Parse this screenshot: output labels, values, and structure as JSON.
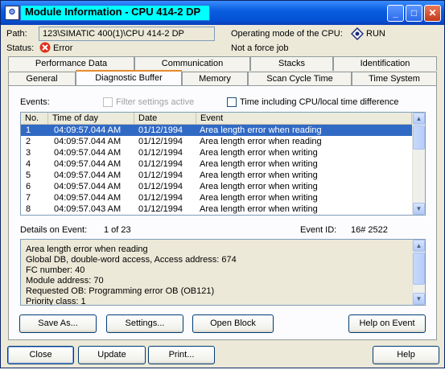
{
  "window": {
    "title": "Module Information - CPU 414-2 DP",
    "icon_glyph": "⚙",
    "minimize_glyph": "_",
    "maximize_glyph": "□",
    "close_glyph": "✕"
  },
  "info": {
    "path_label": "Path:",
    "path_value": "123\\SIMATIC 400(1)\\CPU 414-2 DP",
    "status_label": "Status:",
    "status_value": "Error",
    "mode_label": "Operating mode of the  CPU:",
    "mode_value": "RUN",
    "force_text": "Not a force job"
  },
  "tabs": {
    "row1": [
      "Performance Data",
      "Communication",
      "Stacks",
      "Identification"
    ],
    "row2": [
      "General",
      "Diagnostic Buffer",
      "Memory",
      "Scan Cycle Time",
      "Time System"
    ],
    "active": "Diagnostic Buffer"
  },
  "events": {
    "label": "Events:",
    "filter_label": "Filter settings active",
    "time_diff_label": "Time including CPU/local time difference",
    "columns": [
      "No.",
      "Time of day",
      "Date",
      "Event"
    ],
    "rows": [
      {
        "no": "1",
        "time": "04:09:57.044 AM",
        "date": "01/12/1994",
        "event": "Area length error when reading",
        "selected": true
      },
      {
        "no": "2",
        "time": "04:09:57.044 AM",
        "date": "01/12/1994",
        "event": "Area length error when reading",
        "selected": false
      },
      {
        "no": "3",
        "time": "04:09:57.044 AM",
        "date": "01/12/1994",
        "event": "Area length error when writing",
        "selected": false
      },
      {
        "no": "4",
        "time": "04:09:57.044 AM",
        "date": "01/12/1994",
        "event": "Area length error when writing",
        "selected": false
      },
      {
        "no": "5",
        "time": "04:09:57.044 AM",
        "date": "01/12/1994",
        "event": "Area length error when writing",
        "selected": false
      },
      {
        "no": "6",
        "time": "04:09:57.044 AM",
        "date": "01/12/1994",
        "event": "Area length error when writing",
        "selected": false
      },
      {
        "no": "7",
        "time": "04:09:57.044 AM",
        "date": "01/12/1994",
        "event": "Area length error when writing",
        "selected": false
      },
      {
        "no": "8",
        "time": "04:09:57.043 AM",
        "date": "01/12/1994",
        "event": "Area length error when writing",
        "selected": false
      }
    ]
  },
  "details": {
    "label": "Details on Event:",
    "counter": "1 of 23",
    "event_id_label": "Event ID:",
    "event_id_value": "16# 2522",
    "lines": [
      "Area length error when reading",
      "Global DB, double-word access, Access address:    674",
      "FC number:    40",
      "Module address:    70",
      "Requested OB: Programming error OB (OB121)",
      "Priority class:  1"
    ]
  },
  "panel_buttons": {
    "save_as": "Save As...",
    "settings": "Settings...",
    "open_block": "Open Block",
    "help_event": "Help on Event"
  },
  "footer_buttons": {
    "close": "Close",
    "update": "Update",
    "print": "Print...",
    "help": "Help"
  },
  "colors": {
    "selection": "#316ac5",
    "title_highlight": "#00ffff",
    "error_icon": "#e0301e"
  }
}
